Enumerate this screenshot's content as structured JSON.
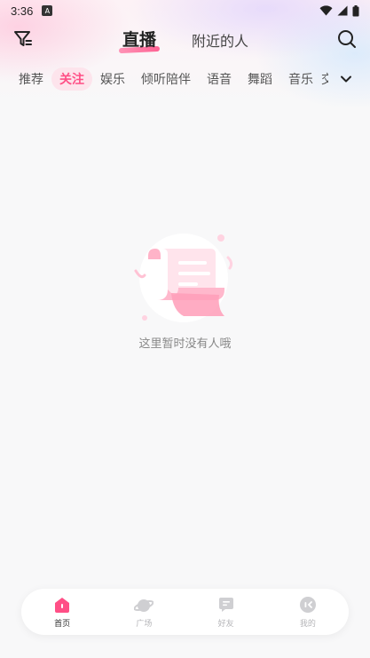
{
  "status_bar": {
    "time": "3:36",
    "app_badge": "A"
  },
  "header": {
    "tabs": [
      {
        "label": "直播",
        "active": true
      },
      {
        "label": "附近的人",
        "active": false
      }
    ]
  },
  "categories": {
    "items": [
      "推荐",
      "关注",
      "娱乐",
      "倾听陪伴",
      "语音",
      "舞蹈",
      "音乐"
    ],
    "active_index": 1,
    "overflow_text": "交"
  },
  "empty_state": {
    "message": "这里暂时没有人哦"
  },
  "bottom_nav": {
    "items": [
      {
        "label": "首页",
        "icon": "home-icon",
        "active": true
      },
      {
        "label": "广场",
        "icon": "planet-icon",
        "active": false
      },
      {
        "label": "好友",
        "icon": "chat-icon",
        "active": false
      },
      {
        "label": "我的",
        "icon": "profile-icon",
        "active": false
      }
    ]
  },
  "colors": {
    "accent": "#ff4f86",
    "accent_bg": "#fde4ec",
    "inactive_icon": "#c9c9cc"
  }
}
